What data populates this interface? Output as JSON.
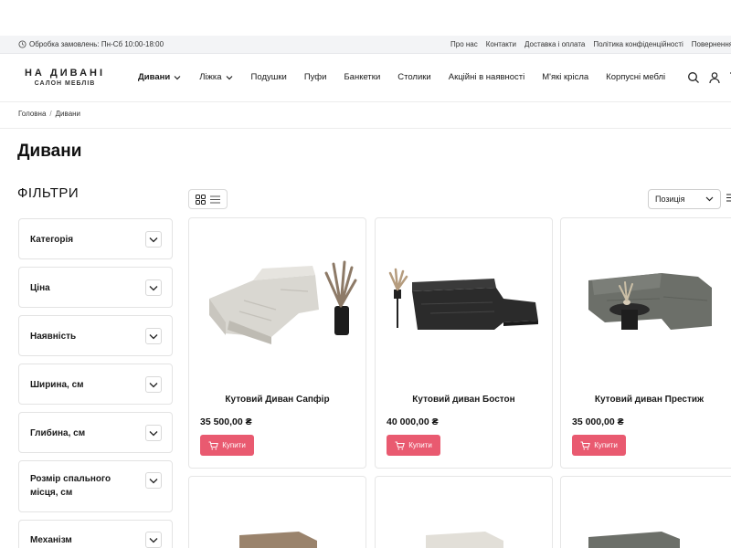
{
  "topbar": {
    "hours": "Обробка замовлень: Пн-Сб 10:00-18:00",
    "links": [
      "Про нас",
      "Контакти",
      "Доставка і оплата",
      "Політика конфіденційності",
      "Повернення і обм"
    ]
  },
  "logo": {
    "line1": "НА ДИВАНІ",
    "line2": "САЛОН МЕБЛІВ"
  },
  "nav": {
    "items": [
      {
        "label": "Дивани",
        "dropdown": true,
        "active": true
      },
      {
        "label": "Ліжка",
        "dropdown": true
      },
      {
        "label": "Подушки"
      },
      {
        "label": "Пуфи"
      },
      {
        "label": "Банкетки"
      },
      {
        "label": "Столики"
      },
      {
        "label": "Акційні в наявності"
      },
      {
        "label": "М'які крісла"
      },
      {
        "label": "Корпусні меблі"
      }
    ]
  },
  "breadcrumb": {
    "home": "Головна",
    "separator": "/",
    "current": "Дивани"
  },
  "page_title": "Дивани",
  "filters": {
    "title": "ФІЛЬТРИ",
    "items": [
      "Категорія",
      "Ціна",
      "Наявність",
      "Ширина, см",
      "Глибина, см",
      "Розмір спального місця, см",
      "Механізм трансформації"
    ]
  },
  "sort": {
    "selected": "Позиція"
  },
  "products": [
    {
      "name": "Кутовий Диван Сапфір",
      "price": "35 500,00 ₴",
      "buy_label": "Купити",
      "color": "#d9d7d1"
    },
    {
      "name": "Кутовий диван Бостон",
      "price": "40 000,00 ₴",
      "buy_label": "Купити",
      "color": "#2b2b2b"
    },
    {
      "name": "Кутовий диван Престиж",
      "price": "35 000,00 ₴",
      "buy_label": "Купити",
      "color": "#6c6f69"
    }
  ],
  "colors": {
    "accent": "#e95a70",
    "topbar_bg": "#f3f4f6"
  }
}
